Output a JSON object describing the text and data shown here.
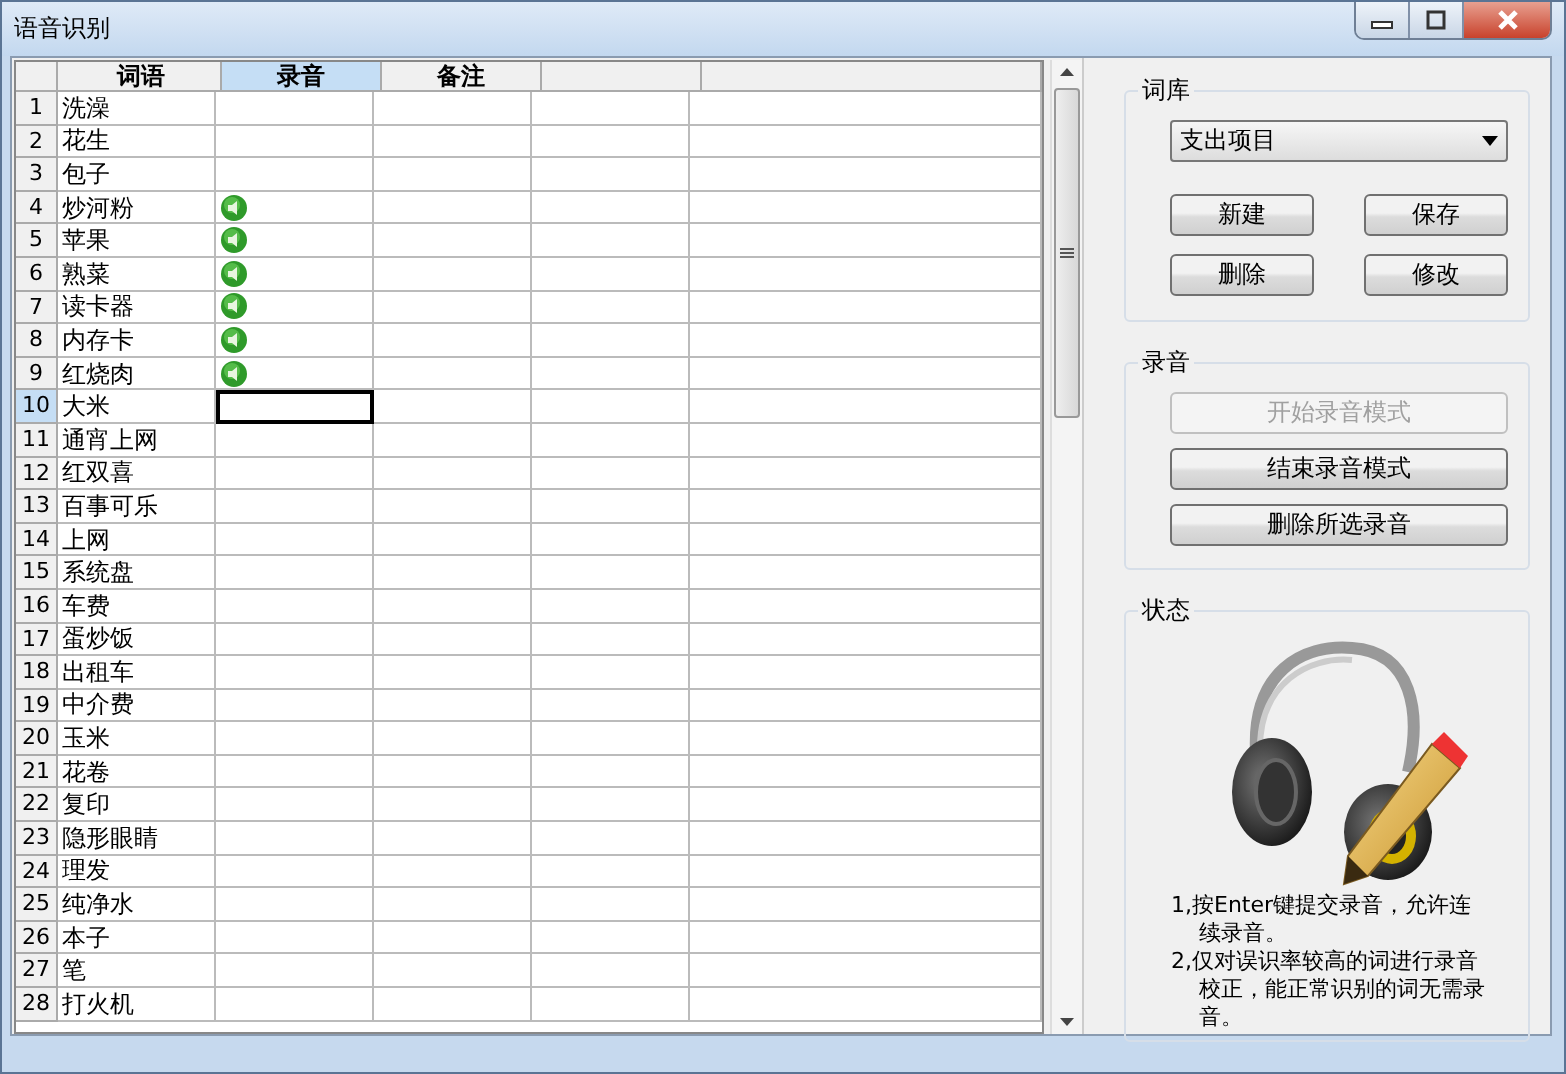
{
  "window": {
    "title": "语音识别"
  },
  "table": {
    "columns": [
      {
        "label": "词语",
        "selected": false
      },
      {
        "label": "录音",
        "selected": true
      },
      {
        "label": "备注",
        "selected": false
      },
      {
        "selected": false
      },
      {
        "selected": false
      }
    ],
    "rows": [
      {
        "num": "1",
        "word": "洗澡",
        "recorded": false,
        "selected": false
      },
      {
        "num": "2",
        "word": "花生",
        "recorded": false,
        "selected": false
      },
      {
        "num": "3",
        "word": "包子",
        "recorded": false,
        "selected": false
      },
      {
        "num": "4",
        "word": "炒河粉",
        "recorded": true,
        "selected": false
      },
      {
        "num": "5",
        "word": "苹果",
        "recorded": true,
        "selected": false
      },
      {
        "num": "6",
        "word": "熟菜",
        "recorded": true,
        "selected": false
      },
      {
        "num": "7",
        "word": "读卡器",
        "recorded": true,
        "selected": false
      },
      {
        "num": "8",
        "word": "内存卡",
        "recorded": true,
        "selected": false
      },
      {
        "num": "9",
        "word": "红烧肉",
        "recorded": true,
        "selected": false
      },
      {
        "num": "10",
        "word": "大米",
        "recorded": false,
        "selected": true
      },
      {
        "num": "11",
        "word": "通宵上网",
        "recorded": false,
        "selected": false
      },
      {
        "num": "12",
        "word": "红双喜",
        "recorded": false,
        "selected": false
      },
      {
        "num": "13",
        "word": "百事可乐",
        "recorded": false,
        "selected": false
      },
      {
        "num": "14",
        "word": "上网",
        "recorded": false,
        "selected": false
      },
      {
        "num": "15",
        "word": "系统盘",
        "recorded": false,
        "selected": false
      },
      {
        "num": "16",
        "word": "车费",
        "recorded": false,
        "selected": false
      },
      {
        "num": "17",
        "word": "蛋炒饭",
        "recorded": false,
        "selected": false
      },
      {
        "num": "18",
        "word": "出租车",
        "recorded": false,
        "selected": false
      },
      {
        "num": "19",
        "word": "中介费",
        "recorded": false,
        "selected": false
      },
      {
        "num": "20",
        "word": "玉米",
        "recorded": false,
        "selected": false
      },
      {
        "num": "21",
        "word": "花卷",
        "recorded": false,
        "selected": false
      },
      {
        "num": "22",
        "word": "复印",
        "recorded": false,
        "selected": false
      },
      {
        "num": "23",
        "word": "隐形眼睛",
        "recorded": false,
        "selected": false
      },
      {
        "num": "24",
        "word": "理发",
        "recorded": false,
        "selected": false
      },
      {
        "num": "25",
        "word": "纯净水",
        "recorded": false,
        "selected": false
      },
      {
        "num": "26",
        "word": "本子",
        "recorded": false,
        "selected": false
      },
      {
        "num": "27",
        "word": "笔",
        "recorded": false,
        "selected": false
      },
      {
        "num": "28",
        "word": "打火机",
        "recorded": false,
        "selected": false
      }
    ]
  },
  "lexicon": {
    "title": "词库",
    "dropdown": "支出项目",
    "buttons": [
      "新建",
      "保存",
      "删除",
      "修改"
    ]
  },
  "recording": {
    "title": "录音",
    "buttons": [
      {
        "label": "开始录音模式",
        "disabled": true
      },
      {
        "label": "结束录音模式",
        "disabled": false
      },
      {
        "label": "删除所选录音",
        "disabled": false
      }
    ]
  },
  "status": {
    "title": "状态",
    "notes": [
      "1,按Enter键提交录音，允许连续录音。",
      "2,仅对误识率较高的词进行录音校正，能正常识别的词无需录音。"
    ]
  }
}
